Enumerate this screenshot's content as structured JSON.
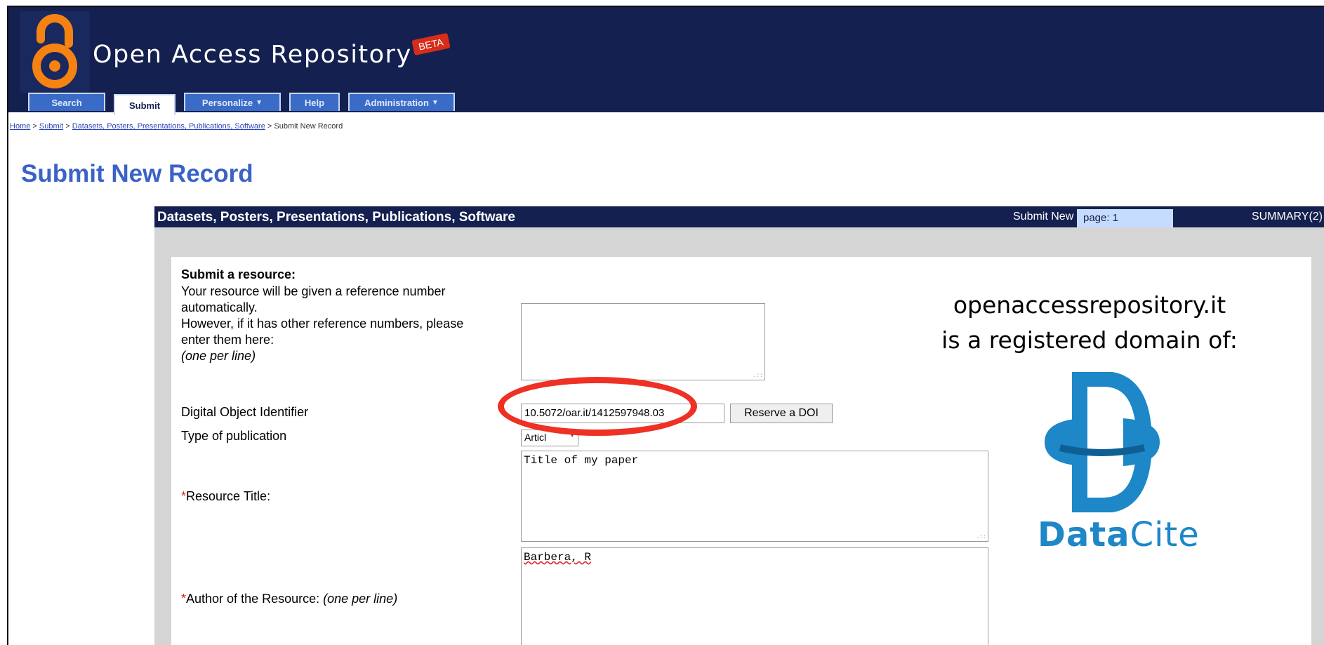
{
  "site": {
    "title": "Open Access Repository",
    "beta_label": "BETA"
  },
  "tabs": [
    {
      "label": "Search",
      "dropdown": false,
      "active": false
    },
    {
      "label": "Submit",
      "dropdown": false,
      "active": true
    },
    {
      "label": "Personalize",
      "dropdown": true,
      "active": false
    },
    {
      "label": "Help",
      "dropdown": false,
      "active": false
    },
    {
      "label": "Administration",
      "dropdown": true,
      "active": false
    }
  ],
  "breadcrumb": {
    "home": "Home",
    "sep1": " > ",
    "submit": "Submit",
    "sep2": " > ",
    "collection": "Datasets, Posters, Presentations, Publications, Software",
    "sep3": "  > ",
    "current": "Submit New Record"
  },
  "page_title": "Submit New Record",
  "panel": {
    "collection": "Datasets, Posters, Presentations, Publications, Software",
    "subtitle": "Submit New Record",
    "page_label": "page: 1",
    "summary": "SUMMARY(2)"
  },
  "form": {
    "heading": "Submit a resource:",
    "ref_label_1": "Your resource will be given a reference number",
    "ref_label_2": "automatically.",
    "ref_label_3": "However, if it has other reference numbers, please",
    "ref_label_4": "enter them here:",
    "ref_label_5": "(one per line)",
    "ref_value": "",
    "doi_label": "Digital Object Identifier",
    "doi_value": "10.5072/oar.it/1412597948.03",
    "reserve_doi_button": "Reserve a DOI",
    "pubtype_label": "Type of publication",
    "pubtype_value": "Articl",
    "required_mark": "*",
    "title_label": "Resource Title:",
    "title_value": "Title of my paper",
    "author_label": "Author of the Resource: ",
    "author_hint": "(one per line)",
    "author_value": "Barbera, R"
  },
  "annotation": {
    "line1": "openaccessrepository.it",
    "line2": "is a registered domain of:",
    "logo_text_data": "Data",
    "logo_text_cite": "Cite"
  },
  "colors": {
    "header": "#14204f",
    "tab": "#3a6cc7",
    "title": "#3b62c6",
    "oa_orange": "#f68212",
    "highlight": "#ee3124",
    "datacite_blue": "#1d87c7"
  }
}
